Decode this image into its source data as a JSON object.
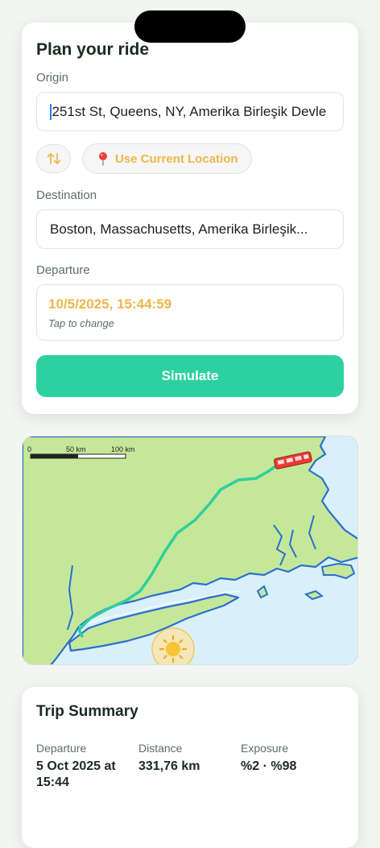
{
  "plan": {
    "title": "Plan your ride",
    "origin_label": "Origin",
    "origin_value": "251st St, Queens, NY, Amerika Birleşik Devle",
    "use_location_label": "Use Current Location",
    "destination_label": "Destination",
    "destination_value": "Boston, Massachusetts, Amerika Birleşik...",
    "departure_label": "Departure",
    "departure_value": "10/5/2025, 15:44:59",
    "departure_hint": "Tap to change",
    "simulate_label": "Simulate"
  },
  "map": {
    "scale_labels": [
      "0",
      "50 km",
      "100 km"
    ],
    "colors": {
      "land": "#c5e79a",
      "water": "#d9f0fb",
      "coast": "#2a6fcf",
      "route": "#2ecf9a",
      "bus": "#e83b35",
      "sun": "#f7c437"
    },
    "icons": [
      "bus-icon",
      "sun-icon"
    ]
  },
  "summary": {
    "title": "Trip Summary",
    "stats": [
      {
        "label": "Departure",
        "value": "5 Oct 2025 at 15:44"
      },
      {
        "label": "Distance",
        "value": "331,76 km"
      },
      {
        "label": "Exposure",
        "value": "%2 · %98"
      }
    ]
  },
  "colors": {
    "accent": "#2dd19f",
    "highlight": "#f0b64a",
    "background": "#f3f5f3"
  }
}
